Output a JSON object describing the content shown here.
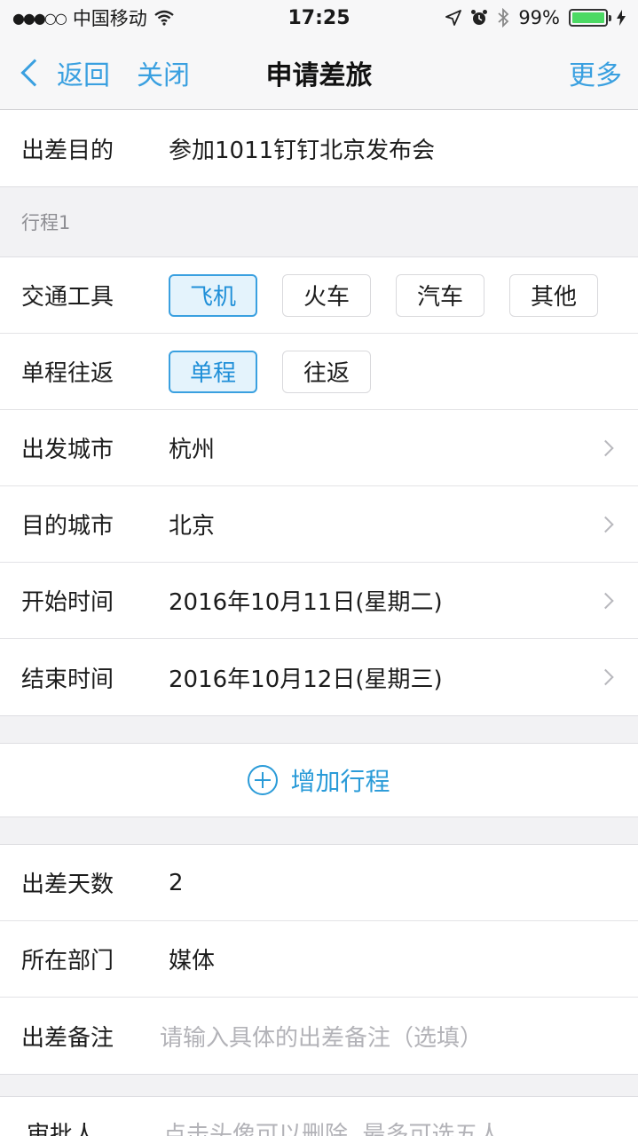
{
  "status_bar": {
    "signal": "●●●○○",
    "carrier": "中国移动",
    "time": "17:25",
    "battery": "99%",
    "battery_level": 0.99
  },
  "nav": {
    "back_label": "返回",
    "close_label": "关闭",
    "title": "申请差旅",
    "more_label": "更多"
  },
  "purpose": {
    "label": "出差目的",
    "value": "参加1011钉钉北京发布会"
  },
  "itinerary": {
    "header": "行程1",
    "transport": {
      "label": "交通工具",
      "options": [
        "飞机",
        "火车",
        "汽车",
        "其他"
      ],
      "selected": "飞机"
    },
    "trip_type": {
      "label": "单程往返",
      "options": [
        "单程",
        "往返"
      ],
      "selected": "单程"
    },
    "departure": {
      "label": "出发城市",
      "value": "杭州"
    },
    "destination": {
      "label": "目的城市",
      "value": "北京"
    },
    "start": {
      "label": "开始时间",
      "value": "2016年10月11日(星期二)"
    },
    "end": {
      "label": "结束时间",
      "value": "2016年10月12日(星期三)"
    }
  },
  "add_itinerary_label": "增加行程",
  "summary": {
    "days": {
      "label": "出差天数",
      "value": "2"
    },
    "department": {
      "label": "所在部门",
      "value": "媒体"
    },
    "remark": {
      "label": "出差备注",
      "placeholder": "请输入具体的出差备注（选填）"
    }
  },
  "approver": {
    "label": "审批人",
    "hint": "点击头像可以删除, 最多可选五人"
  },
  "colors": {
    "accent": "#3aa0e0",
    "selected_bg": "#e4f3fc",
    "background": "#f2f2f4"
  }
}
